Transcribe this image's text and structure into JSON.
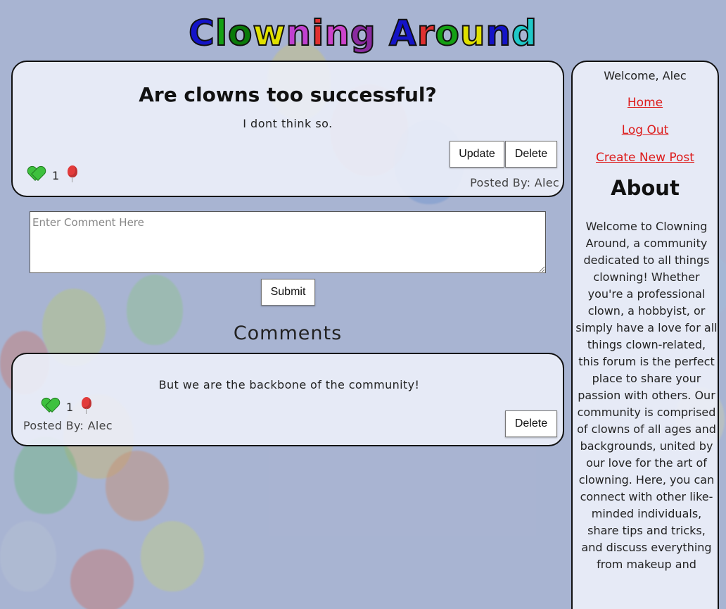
{
  "site": {
    "title_letters": [
      {
        "ch": "C",
        "color": "#1414c8"
      },
      {
        "ch": "l",
        "color": "#14a014"
      },
      {
        "ch": "o",
        "color": "#0a7a0a"
      },
      {
        "ch": "w",
        "color": "#e0e000"
      },
      {
        "ch": "n",
        "color": "#c040d0"
      },
      {
        "ch": "i",
        "color": "#e03030"
      },
      {
        "ch": "n",
        "color": "#cc44cc"
      },
      {
        "ch": "g",
        "color": "#8a2aa0"
      },
      {
        "ch": " ",
        "color": "#000000"
      },
      {
        "ch": "A",
        "color": "#1414c8"
      },
      {
        "ch": "r",
        "color": "#e03030"
      },
      {
        "ch": "o",
        "color": "#14a014"
      },
      {
        "ch": "u",
        "color": "#e0e000"
      },
      {
        "ch": "n",
        "color": "#1414c8"
      },
      {
        "ch": "d",
        "color": "#20c8c8"
      }
    ]
  },
  "post": {
    "title": "Are clowns too successful?",
    "body": "I dont think so.",
    "update_label": "Update",
    "delete_label": "Delete",
    "like_count": "1",
    "posted_by": "Posted By: Alec"
  },
  "comment_form": {
    "placeholder": "Enter Comment Here",
    "submit_label": "Submit"
  },
  "comments": {
    "heading": "Comments",
    "items": [
      {
        "body": "But we are the backbone of the community!",
        "like_count": "1",
        "posted_by": "Posted By: Alec",
        "delete_label": "Delete"
      }
    ]
  },
  "sidebar": {
    "welcome": "Welcome, Alec",
    "links": [
      "Home",
      "Log Out",
      "Create New Post"
    ],
    "about_heading": "About",
    "about_text": "Welcome to Clowning Around, a community dedicated to all things clowning! Whether you're a professional clown, a hobbyist, or simply have a love for all things clown-related, this forum is the perfect place to share your passion with others. Our community is comprised of clowns of all ages and backgrounds, united by our love for the art of clowning. Here, you can connect with other like-minded individuals, share tips and tricks, and discuss everything from makeup and"
  },
  "colors": {
    "link": "#dd1c1c",
    "like_heart": "#3ec13e",
    "balloon": "#e23b3b"
  },
  "icons": {
    "like": "green-heart-icon",
    "dislike": "red-balloon-icon"
  }
}
